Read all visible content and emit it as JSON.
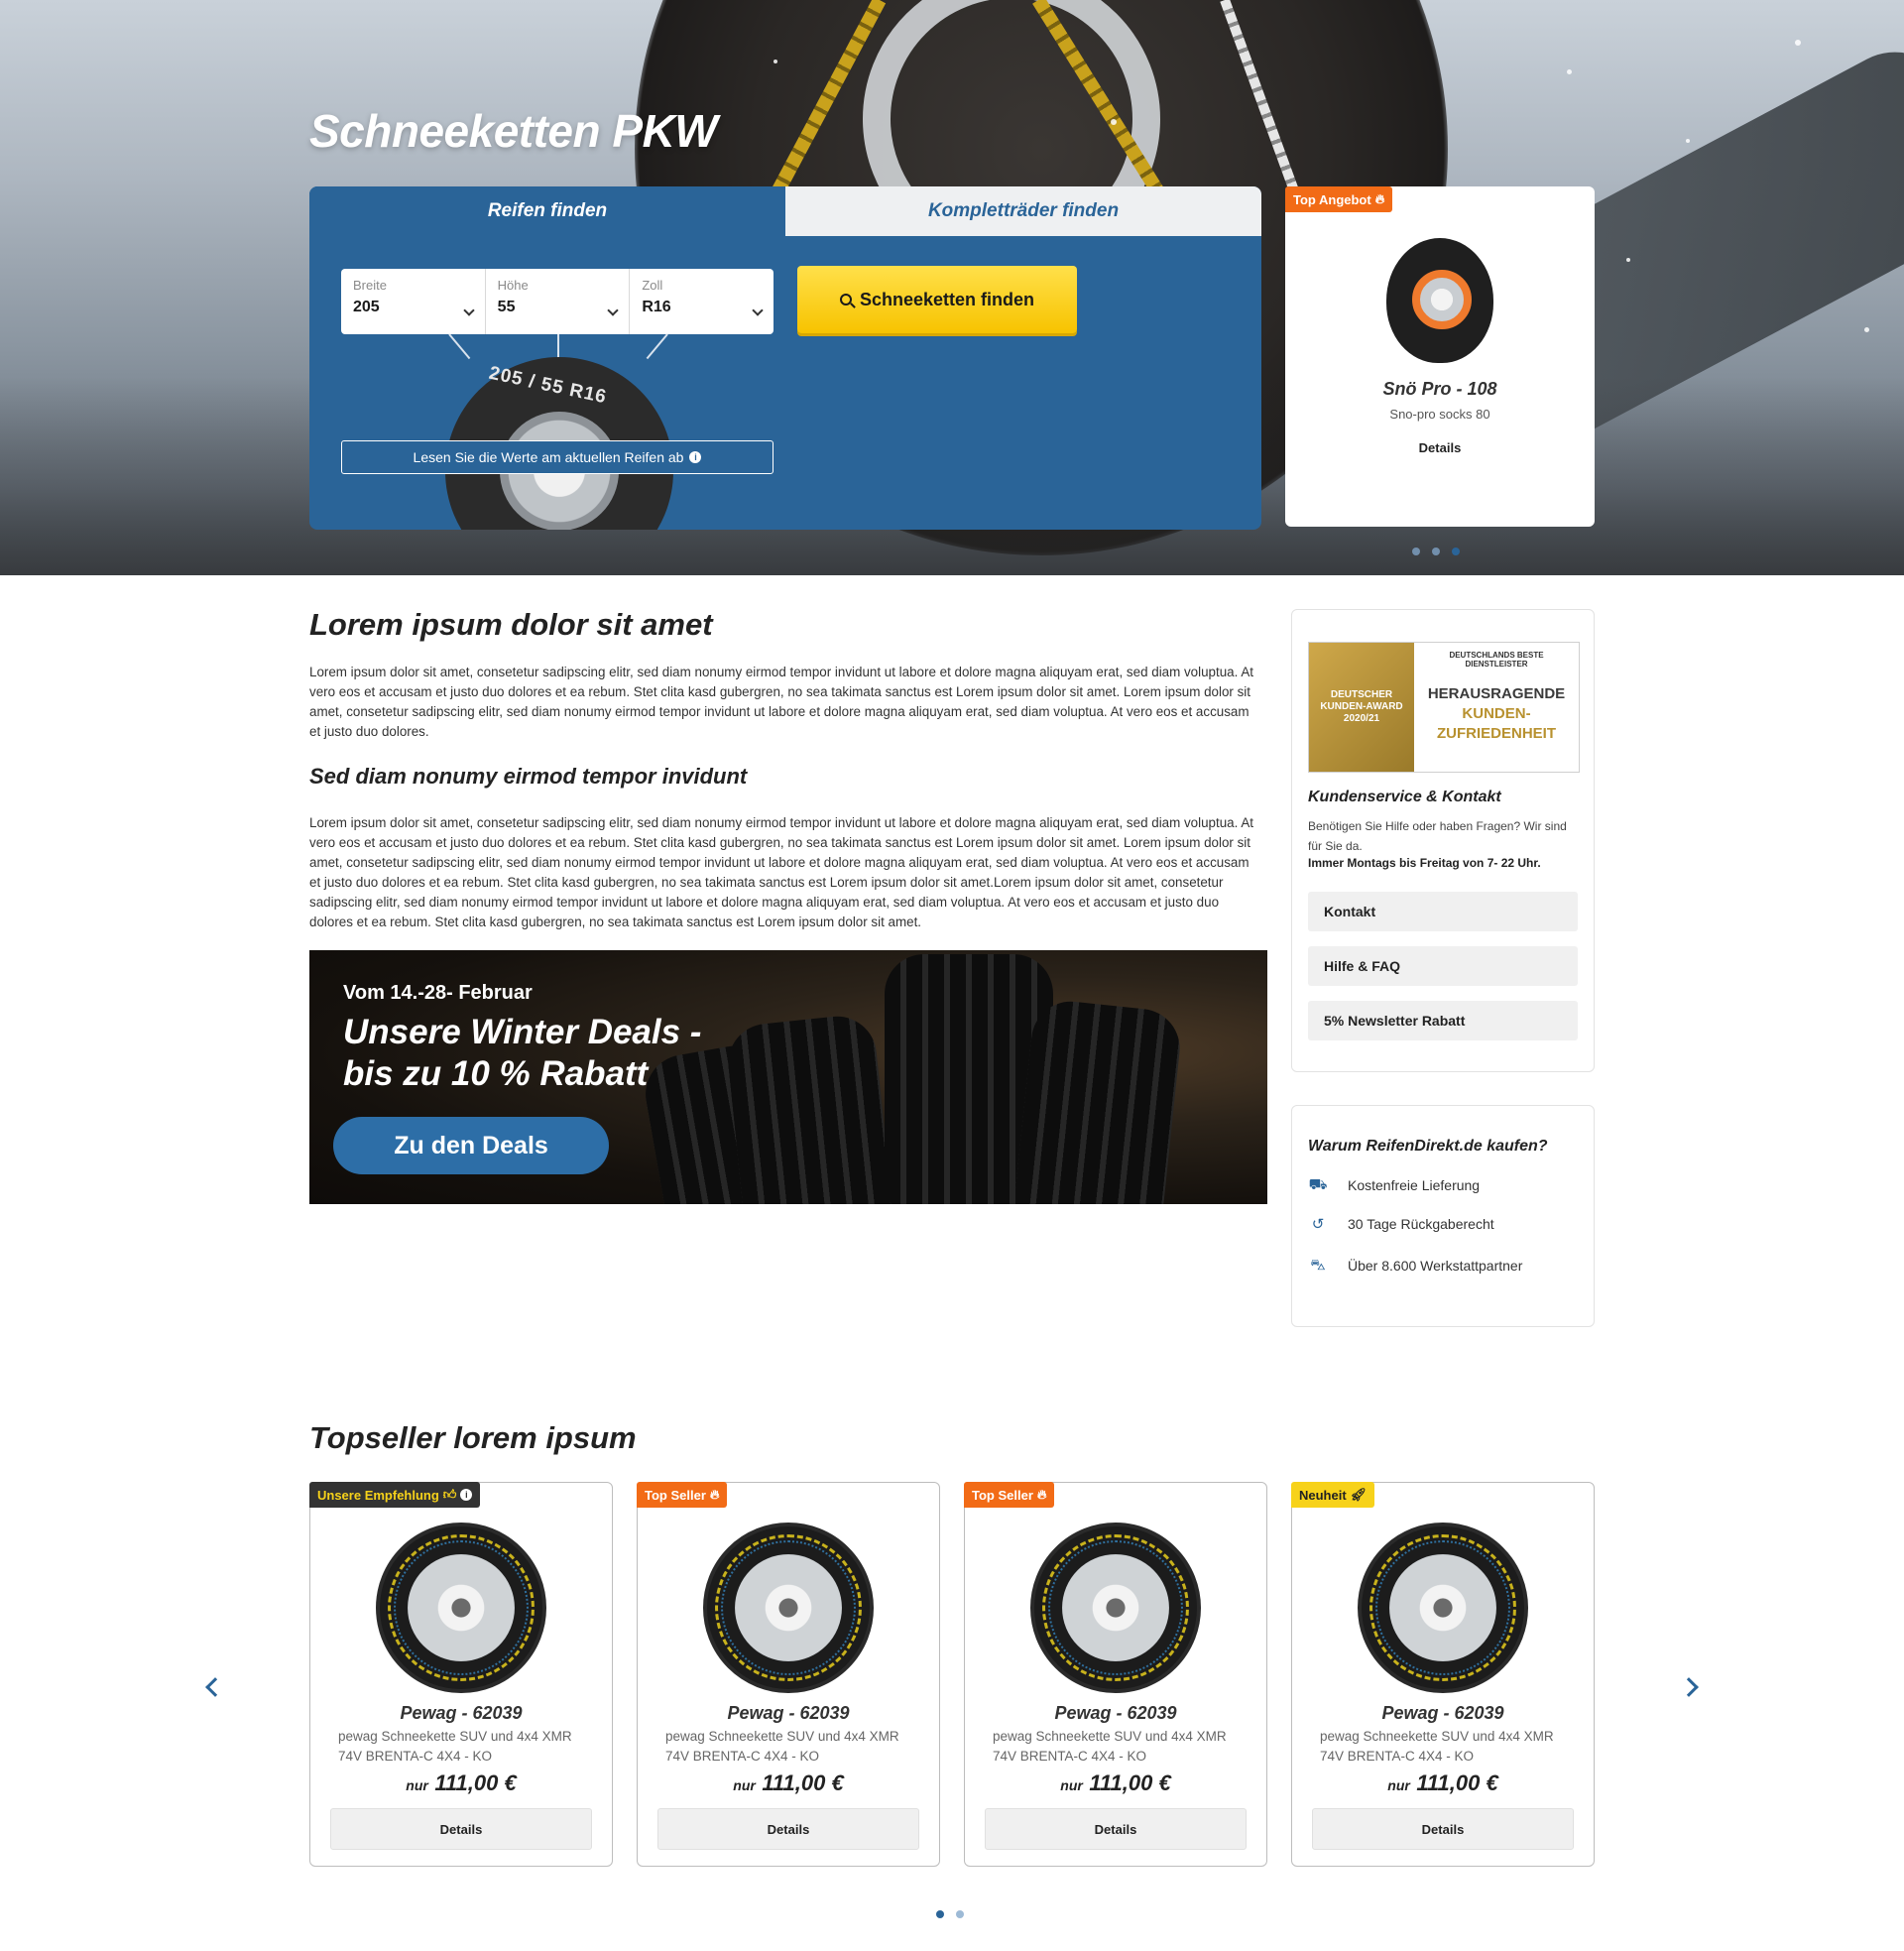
{
  "hero": {
    "title": "Schneeketten PKW",
    "tabs": [
      {
        "label": "Reifen finden",
        "active": true
      },
      {
        "label": "Kompletträder finden",
        "active": false
      }
    ],
    "selects": [
      {
        "label": "Breite",
        "value": "205"
      },
      {
        "label": "Höhe",
        "value": "55"
      },
      {
        "label": "Zoll",
        "value": "R16"
      }
    ],
    "tire_size": "205 / 55 R16",
    "read_hint": "Lesen Sie die Werte am aktuellen Reifen ab",
    "search_button": "Schneeketten finden",
    "offer": {
      "badge": "Top Angebot",
      "name": "Snö Pro - 108",
      "subtitle": "Sno-pro socks 80",
      "link": "Details"
    },
    "slider_dots": 3,
    "slider_active": 3
  },
  "content": {
    "heading1": "Lorem ipsum dolor sit amet",
    "paragraph1": "Lorem ipsum dolor sit amet, consetetur sadipscing elitr, sed diam nonumy eirmod tempor invidunt ut labore et dolore magna aliquyam erat, sed diam voluptua. At vero eos et accusam et justo duo dolores et ea rebum. Stet clita kasd gubergren, no sea takimata sanctus est Lorem ipsum dolor sit amet. Lorem ipsum dolor sit amet, consetetur sadipscing elitr, sed diam nonumy eirmod tempor invidunt ut labore et dolore magna aliquyam erat, sed diam voluptua. At vero eos et accusam et justo duo dolores.",
    "heading2": "Sed diam nonumy eirmod tempor invidunt",
    "paragraph2": "Lorem ipsum dolor sit amet, consetetur sadipscing elitr, sed diam nonumy eirmod tempor invidunt ut labore et dolore magna aliquyam erat, sed diam voluptua. At vero eos et accusam et justo duo dolores et ea rebum. Stet clita kasd gubergren, no sea takimata sanctus est Lorem ipsum dolor sit amet. Lorem ipsum dolor sit amet, consetetur sadipscing elitr, sed diam nonumy eirmod tempor invidunt ut labore et dolore magna aliquyam erat, sed diam voluptua. At vero eos et accusam et justo duo dolores et ea rebum. Stet clita kasd gubergren, no sea takimata sanctus est Lorem ipsum dolor sit amet.Lorem ipsum dolor sit amet, consetetur sadipscing elitr, sed diam nonumy eirmod tempor invidunt ut labore et dolore magna aliquyam erat, sed diam voluptua. At vero eos et accusam et justo duo dolores et ea rebum. Stet clita kasd gubergren, no sea takimata sanctus est Lorem ipsum dolor sit amet."
  },
  "banner": {
    "date": "Vom 14.-28- Februar",
    "headline": "Unsere Winter Deals - bis zu 10 % Rabatt",
    "cta": "Zu den Deals"
  },
  "sidebar": {
    "award": {
      "seal_text": "DEUTSCHER KUNDEN-AWARD 2020/21",
      "top_text": "DEUTSCHLANDS BESTE DIENSTLEISTER",
      "line1": "HERAUSRAGENDE",
      "line2": "KUNDEN-",
      "line3": "ZUFRIEDENHEIT"
    },
    "service_title": "Kundenservice & Kontakt",
    "service_desc": "Benötigen Sie Hilfe oder haben Fragen? Wir sind für Sie da.",
    "service_hours": "Immer Montags bis Freitag von 7- 22 Uhr.",
    "buttons": [
      "Kontakt",
      "Hilfe & FAQ",
      "5% Newsletter Rabatt"
    ],
    "why_title": "Warum ReifenDirekt.de kaufen?",
    "features": [
      {
        "icon": "truck-icon",
        "label": "Kostenfreie Lieferung"
      },
      {
        "icon": "return-icon",
        "label": "30 Tage Rückgaberecht"
      },
      {
        "icon": "car-service-icon",
        "label": "Über 8.600 Werkstattpartner"
      }
    ]
  },
  "topseller": {
    "title": "Topseller lorem ipsum",
    "products": [
      {
        "badge": "Unsere Empfehlung",
        "badge_style": "dark",
        "name": "Pewag - 62039",
        "desc": "pewag Schneekette SUV und 4x4 XMR 74V BRENTA-C 4X4 - KO",
        "price_prefix": "nur",
        "price": "111,00 €",
        "button": "Details"
      },
      {
        "badge": "Top Seller",
        "badge_style": "orange",
        "name": "Pewag - 62039",
        "desc": "pewag Schneekette SUV und 4x4 XMR 74V BRENTA-C 4X4 - KO",
        "price_prefix": "nur",
        "price": "111,00 €",
        "button": "Details"
      },
      {
        "badge": "Top Seller",
        "badge_style": "orange",
        "name": "Pewag - 62039",
        "desc": "pewag Schneekette SUV und 4x4 XMR 74V BRENTA-C 4X4 - KO",
        "price_prefix": "nur",
        "price": "111,00 €",
        "button": "Details"
      },
      {
        "badge": "Neuheit",
        "badge_style": "yellow",
        "name": "Pewag - 62039",
        "desc": "pewag Schneekette SUV und 4x4 XMR 74V BRENTA-C 4X4 - KO",
        "price_prefix": "nur",
        "price": "111,00 €",
        "button": "Details"
      }
    ],
    "pagination_dots": 2,
    "pagination_active": 1
  },
  "colors": {
    "primary_blue": "#2a6498",
    "accent_yellow": "#f7c300",
    "badge_orange": "#f26b16"
  }
}
